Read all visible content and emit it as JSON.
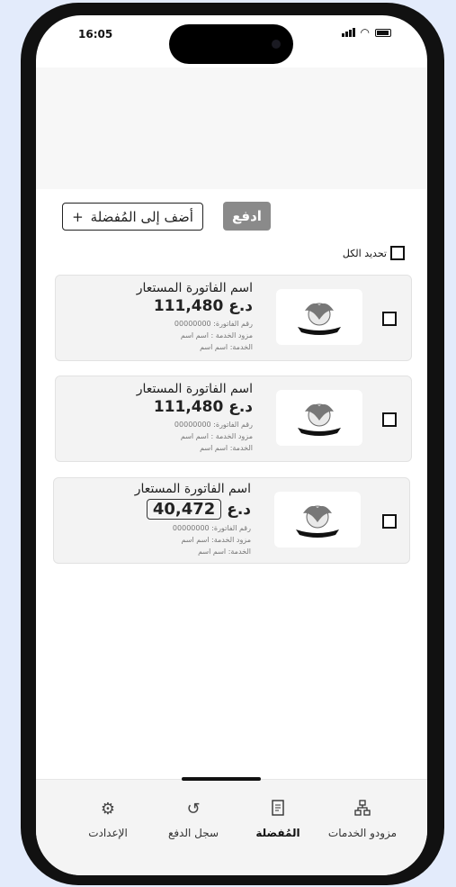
{
  "status_bar": {
    "time": "16:05"
  },
  "actions": {
    "add_favorite_label": "أضف إلى المُفضلة",
    "add_favorite_plus": "+",
    "pay_label": "ادفع"
  },
  "select_all": {
    "label": "تحديد الكل"
  },
  "bills": [
    {
      "name": "اسم الفاتورة المستعار",
      "amount": "111,480",
      "currency": "د.ع",
      "bill_number": "رقم الفاتورة: 00000000",
      "provider": "مزود الخدمة : اسم اسم",
      "service": "الخدمة: اسم اسم",
      "editable": false
    },
    {
      "name": "اسم الفاتورة المستعار",
      "amount": "111,480",
      "currency": "د.ع",
      "bill_number": "رقم الفاتورة: 00000000",
      "provider": "مزود الخدمة : اسم اسم",
      "service": "الخدمة: اسم اسم",
      "editable": false
    },
    {
      "name": "اسم الفاتورة المستعار",
      "amount": "40,472",
      "currency": "د.ع",
      "bill_number": "رقم الفاتورة: 00000000",
      "provider": "مزود الخدمة: اسم اسم",
      "service": "الخدمة: اسم اسم",
      "editable": true
    }
  ],
  "bottom_nav": [
    {
      "label": "الإعدادت",
      "icon": "gear-icon"
    },
    {
      "label": "سجل الدفع",
      "icon": "history-icon"
    },
    {
      "label": "المُفضلة",
      "icon": "receipt-icon",
      "active": true
    },
    {
      "label": "مزودو الخدمات",
      "icon": "sitemap-icon"
    }
  ]
}
